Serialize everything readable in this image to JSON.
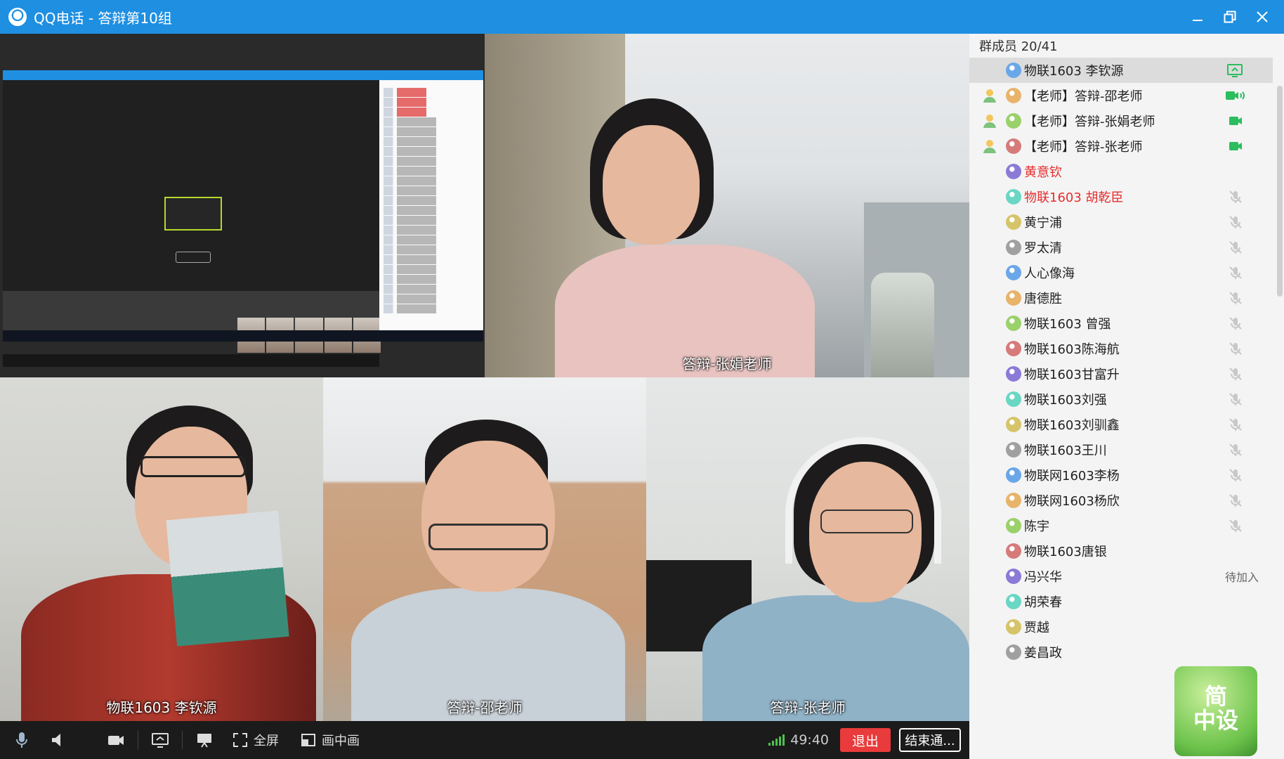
{
  "window": {
    "app_name": "QQ电话",
    "separator": " - ",
    "group_name": "答辩第10组",
    "controls": [
      "minimize",
      "restore",
      "close"
    ]
  },
  "videos": [
    {
      "id": "share",
      "caption": ""
    },
    {
      "id": "a",
      "caption": "答辩-张娟老师"
    },
    {
      "id": "b",
      "caption": "物联1603 李钦源"
    },
    {
      "id": "c",
      "caption": "答辩-邵老师"
    },
    {
      "id": "d",
      "caption": "答辩-张老师"
    }
  ],
  "toolbar": {
    "fullscreen_label": "全屏",
    "pip_label": "画中画",
    "timer": "49:40",
    "exit_label": "退出",
    "end_label": "结束通..."
  },
  "members": {
    "header": "群成员 20/41",
    "list": [
      {
        "name": "物联1603 李钦源",
        "state": "screen-share-icon",
        "host": false,
        "red": false
      },
      {
        "name": "【老师】答辩-邵老师",
        "state": "video-speaking-icon",
        "host": true,
        "red": false
      },
      {
        "name": "【老师】答辩-张娟老师",
        "state": "video-icon",
        "host": true,
        "red": false
      },
      {
        "name": "【老师】答辩-张老师",
        "state": "video-icon",
        "host": true,
        "red": false
      },
      {
        "name": "黄意钦",
        "state": "",
        "host": false,
        "red": true
      },
      {
        "name": "物联1603 胡乾臣",
        "state": "muted-icon",
        "host": false,
        "red": true
      },
      {
        "name": "黄宁浦",
        "state": "muted-icon",
        "host": false,
        "red": false
      },
      {
        "name": "罗太清",
        "state": "muted-icon",
        "host": false,
        "red": false
      },
      {
        "name": "人心像海",
        "state": "muted-icon",
        "host": false,
        "red": false
      },
      {
        "name": "唐德胜",
        "state": "muted-icon",
        "host": false,
        "red": false
      },
      {
        "name": "物联1603  曾强",
        "state": "muted-icon",
        "host": false,
        "red": false
      },
      {
        "name": "物联1603陈海航",
        "state": "muted-icon",
        "host": false,
        "red": false
      },
      {
        "name": "物联1603甘富升",
        "state": "muted-icon",
        "host": false,
        "red": false
      },
      {
        "name": "物联1603刘强",
        "state": "muted-icon",
        "host": false,
        "red": false
      },
      {
        "name": "物联1603刘驯鑫",
        "state": "muted-icon",
        "host": false,
        "red": false
      },
      {
        "name": "物联1603王川",
        "state": "muted-icon",
        "host": false,
        "red": false
      },
      {
        "name": "物联网1603李杨",
        "state": "muted-icon",
        "host": false,
        "red": false
      },
      {
        "name": "物联网1603杨欣",
        "state": "muted-icon",
        "host": false,
        "red": false
      },
      {
        "name": "陈宇",
        "state": "muted-icon",
        "host": false,
        "red": false
      },
      {
        "name": "物联1603唐银",
        "state": "",
        "host": false,
        "red": false
      },
      {
        "name": "冯兴华",
        "state": "",
        "host": false,
        "red": false,
        "status_text": "待加入"
      },
      {
        "name": "胡荣春",
        "state": "",
        "host": false,
        "red": false
      },
      {
        "name": "贾越",
        "state": "",
        "host": false,
        "red": false
      },
      {
        "name": "姜昌政",
        "state": "",
        "host": false,
        "red": false
      }
    ]
  },
  "watermark": {
    "line1": "简",
    "line2": "中设"
  },
  "colors": {
    "titlebar": "#1e8fe1",
    "exit": "#e93b3b",
    "video_on": "#2bbd5e",
    "muted": "#c8c8c8",
    "highlight_name": "#e62e2e"
  }
}
